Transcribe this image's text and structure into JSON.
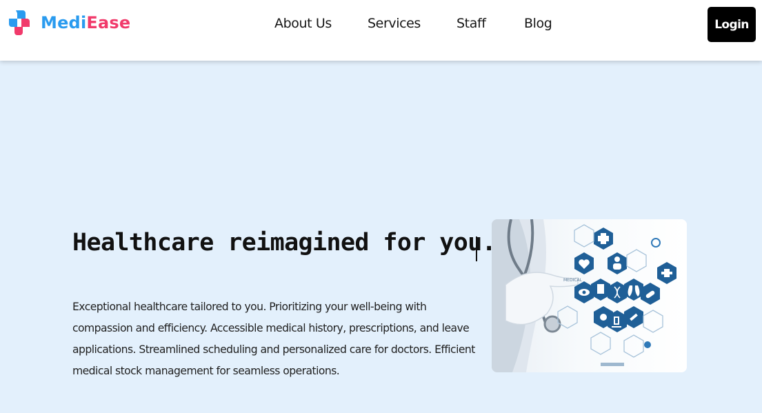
{
  "brand": {
    "name_part1": "Medi",
    "name_part2": "Ease",
    "logo_icon": "cross-logo-icon",
    "color_part1": "#2a9bef",
    "color_part2": "#f13a6b"
  },
  "nav": {
    "links": [
      {
        "label": "About Us"
      },
      {
        "label": "Services"
      },
      {
        "label": "Staff"
      },
      {
        "label": "Blog"
      }
    ],
    "login_label": "Login"
  },
  "hero": {
    "title": "Healthcare reimagined for you...",
    "description": "Exceptional healthcare tailored to you. Prioritizing your well-being with compassion and efficiency. Accessible medical history, prescriptions, and leave applications. Streamlined scheduling and personalized care for doctors. Efficient medical stock management for seamless operations.",
    "image": {
      "description": "gloved hand touching medical hexagon icons",
      "badge_text": "MEDICAL",
      "icons": [
        "heart-icon",
        "medical-cross-icon",
        "person-icon",
        "clipboard-icon",
        "eye-icon",
        "lungs-icon",
        "dna-icon",
        "pill-icon",
        "microscope-icon",
        "syringe-icon",
        "virus-icon",
        "ambulance-icon"
      ]
    }
  },
  "colors": {
    "page_background": "#e3f0fc",
    "nav_background": "#ffffff",
    "login_background": "#000000",
    "hex_blue": "#1f5f97"
  }
}
